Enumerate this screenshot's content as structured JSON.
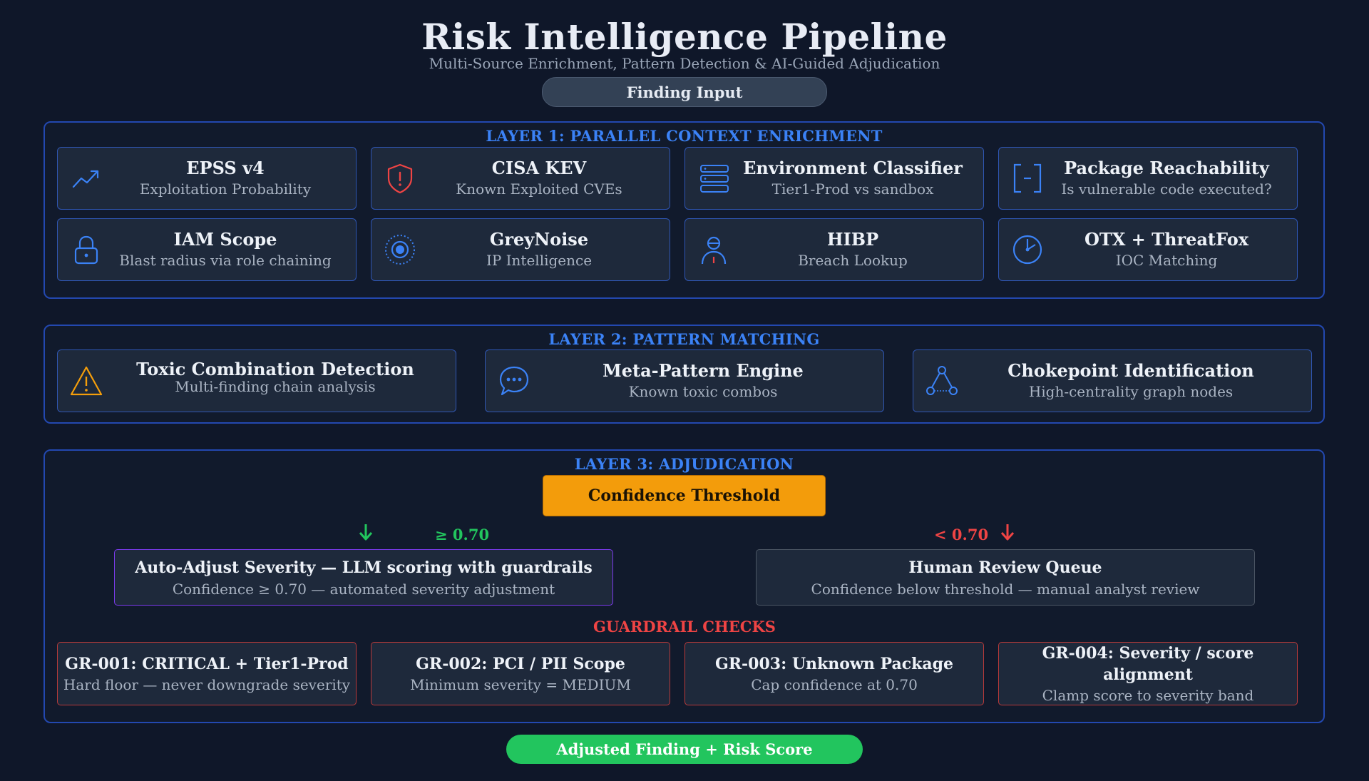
{
  "header": {
    "title": "Risk Intelligence Pipeline",
    "subtitle": "Multi-Source Enrichment, Pattern Detection & AI-Guided Adjudication",
    "input_label": "Finding Input"
  },
  "colors": {
    "background": "#0f1729",
    "layer_border": "#2348b0",
    "accent_blue": "#3b82f6",
    "threshold_orange": "#f39c0b",
    "success_green": "#22c55e",
    "danger_red": "#ef4444",
    "purple_border": "#7c3aed"
  },
  "layer1": {
    "title": "LAYER 1: PARALLEL CONTEXT ENRICHMENT",
    "cards": [
      {
        "title": "EPSS v4",
        "desc": "Exploitation Probability",
        "icon": "trending-up-icon"
      },
      {
        "title": "CISA KEV",
        "desc": "Known Exploited CVEs",
        "icon": "shield-alert-icon"
      },
      {
        "title": "Environment Classifier",
        "desc": "Tier1-Prod vs sandbox",
        "icon": "server-stack-icon"
      },
      {
        "title": "Package Reachability",
        "desc": "Is vulnerable code executed?",
        "icon": "brackets-icon"
      },
      {
        "title": "IAM Scope",
        "desc": "Blast radius via role chaining",
        "icon": "lock-icon"
      },
      {
        "title": "GreyNoise",
        "desc": "IP Intelligence",
        "icon": "radar-target-icon"
      },
      {
        "title": "HIBP",
        "desc": "Breach Lookup",
        "icon": "user-icon"
      },
      {
        "title": "OTX + ThreatFox",
        "desc": "IOC Matching",
        "icon": "clock-icon"
      }
    ]
  },
  "layer2": {
    "title": "LAYER 2: PATTERN MATCHING",
    "cards": [
      {
        "title": "Toxic Combination Detection",
        "desc": "Multi-finding chain analysis",
        "icon": "warning-triangle-icon"
      },
      {
        "title": "Meta-Pattern Engine",
        "desc": "Known toxic combos",
        "icon": "chat-bubble-icon"
      },
      {
        "title": "Chokepoint Identification",
        "desc": "High-centrality graph nodes",
        "icon": "graph-nodes-icon"
      }
    ]
  },
  "layer3": {
    "title": "LAYER 3: ADJUDICATION",
    "threshold_label": "Confidence Threshold",
    "high_label": "≥ 0.70",
    "low_label": "< 0.70",
    "auto": {
      "title": "Auto-Adjust Severity — LLM scoring with guardrails",
      "desc": "Confidence ≥ 0.70 — automated severity adjustment"
    },
    "human": {
      "title": "Human Review Queue",
      "desc": "Confidence below threshold — manual analyst review"
    },
    "guardrail_title": "GUARDRAIL CHECKS",
    "guardrails": [
      {
        "title": "GR-001: CRITICAL + Tier1-Prod",
        "desc": "Hard floor — never downgrade severity"
      },
      {
        "title": "GR-002: PCI / PII Scope",
        "desc": "Minimum severity = MEDIUM"
      },
      {
        "title": "GR-003: Unknown Package",
        "desc": "Cap confidence at 0.70"
      },
      {
        "title": "GR-004: Severity / score alignment",
        "desc": "Clamp score to severity band"
      }
    ]
  },
  "output_label": "Adjusted Finding + Risk Score"
}
